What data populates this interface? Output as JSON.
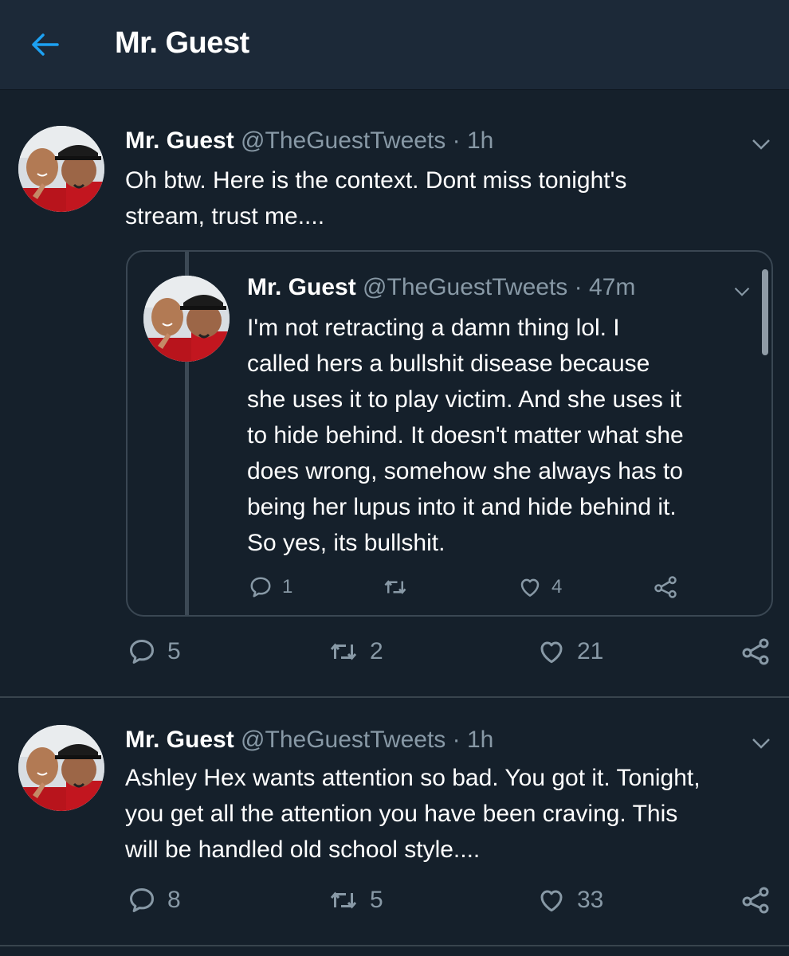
{
  "header": {
    "title": "Mr. Guest"
  },
  "tweets": [
    {
      "name": "Mr. Guest",
      "handle": "@TheGuestTweets",
      "dot": "·",
      "time": "1h",
      "text_lines": [
        "Oh btw. Here is the context. Dont miss tonight's",
        "stream, trust me...."
      ],
      "replies": "5",
      "retweets": "2",
      "likes": "21",
      "quote": {
        "name": "Mr. Guest",
        "handle": "@TheGuestTweets",
        "dot": "·",
        "time": "47m",
        "text_lines": [
          "I'm not retracting a damn thing lol. I",
          "called hers a bullshit disease because",
          "she uses it to play victim. And she uses it",
          "to hide behind. It doesn't matter what she",
          "does wrong, somehow she always has to",
          "being her lupus into it and hide behind it.",
          "So yes, its bullshit."
        ],
        "replies": "1",
        "retweets": "",
        "likes": "4"
      }
    },
    {
      "name": "Mr. Guest",
      "handle": "@TheGuestTweets",
      "dot": "·",
      "time": "1h",
      "text_lines": [
        "Ashley Hex wants attention so bad. You got it. Tonight,",
        "you get all the attention you have been craving. This",
        "will be handled old school style...."
      ],
      "replies": "8",
      "retweets": "5",
      "likes": "33"
    }
  ],
  "icons": {
    "back": "arrow-left-icon",
    "caret": "chevron-down-icon",
    "reply": "reply-icon",
    "retweet": "retweet-icon",
    "like": "heart-icon",
    "share": "share-icon"
  },
  "colors": {
    "background": "#15202b",
    "header": "#1c2938",
    "accent": "#1da1f2",
    "secondary_text": "#8899a6",
    "border": "#38444d"
  }
}
